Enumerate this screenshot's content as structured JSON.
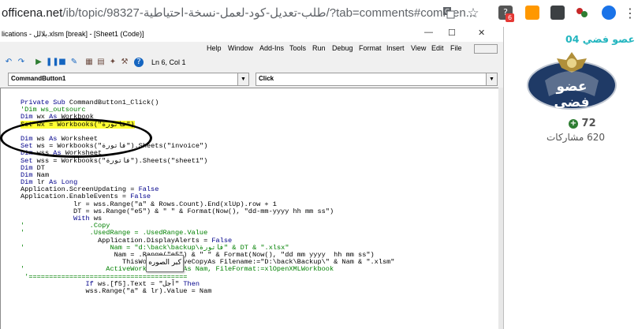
{
  "browser": {
    "url_host": "officena.net",
    "url_path": "/ib/topic/98327-طلب-تعديل-كود-لعمل-نسخة-احتياطية/?tab=comments#commen...",
    "translate_icon": "translate-icon",
    "star_icon": "bookmark-star-icon",
    "extension_badge": "6"
  },
  "vbe": {
    "title": "lications - بلالل.xlsm [break] - [Sheet1 (Code)]",
    "window_controls": {
      "minimize": "—",
      "restore": "☐",
      "close": "✕"
    },
    "menu": [
      "Help",
      "Window",
      "Add-Ins",
      "Tools",
      "Run",
      "Debug",
      "Format",
      "Insert",
      "View",
      "Edit",
      "File"
    ],
    "cursor_position": "Ln 6, Col 1",
    "object_combo": "CommandButton1",
    "procedure_combo": "Click",
    "code_lines": [
      {
        "parts": [
          {
            "t": "Private Sub ",
            "c": "kw"
          },
          {
            "t": "CommandButton1_Click()",
            "c": ""
          }
        ]
      },
      {
        "parts": [
          {
            "t": "'Dim ws_outsourc",
            "c": "cm"
          }
        ]
      },
      {
        "parts": [
          {
            "t": "Dim ",
            "c": "kw"
          },
          {
            "t": "wx ",
            "c": ""
          },
          {
            "t": "As ",
            "c": "kw"
          },
          {
            "t": "Workbook",
            "c": ""
          }
        ]
      },
      {
        "parts": [
          {
            "t": "Set wx = Workbooks(\"فاتورة\")",
            "c": "hl"
          }
        ]
      },
      {
        "parts": []
      },
      {
        "parts": [
          {
            "t": "Dim ",
            "c": "kw"
          },
          {
            "t": "ws ",
            "c": ""
          },
          {
            "t": "As ",
            "c": "kw"
          },
          {
            "t": "Worksheet",
            "c": ""
          }
        ]
      },
      {
        "parts": [
          {
            "t": "Set ",
            "c": "kw"
          },
          {
            "t": "ws = Workbooks(\"فاتورة\").Sheets(\"invoice\")",
            "c": ""
          }
        ]
      },
      {
        "parts": [
          {
            "t": "Dim ",
            "c": "kw"
          },
          {
            "t": "wss ",
            "c": ""
          },
          {
            "t": "As ",
            "c": "kw"
          },
          {
            "t": "Worksheet",
            "c": ""
          }
        ]
      },
      {
        "parts": [
          {
            "t": "Set ",
            "c": "kw"
          },
          {
            "t": "wss = Workbooks(\"فاتورة\").Sheets(\"sheet1\")",
            "c": ""
          }
        ]
      },
      {
        "parts": [
          {
            "t": "Dim ",
            "c": "kw"
          },
          {
            "t": "DT",
            "c": ""
          }
        ]
      },
      {
        "parts": [
          {
            "t": "Dim ",
            "c": "kw"
          },
          {
            "t": "Nam",
            "c": ""
          }
        ]
      },
      {
        "parts": [
          {
            "t": "Dim ",
            "c": "kw"
          },
          {
            "t": "lr ",
            "c": ""
          },
          {
            "t": "As Long",
            "c": "kw"
          }
        ]
      },
      {
        "parts": [
          {
            "t": "Application.ScreenUpdating = ",
            "c": ""
          },
          {
            "t": "False",
            "c": "kw"
          }
        ]
      },
      {
        "parts": [
          {
            "t": "Application.EnableEvents = ",
            "c": ""
          },
          {
            "t": "False",
            "c": "kw"
          }
        ]
      },
      {
        "parts": [
          {
            "t": "             lr = wss.Range(\"a\" & Rows.Count).End(xlUp).row + 1",
            "c": ""
          }
        ]
      },
      {
        "parts": [
          {
            "t": "             DT = ws.Range(\"e5\") & \" \" & Format(Now(), \"dd-mm-yyyy hh mm ss\")",
            "c": ""
          }
        ]
      },
      {
        "parts": [
          {
            "t": "             ",
            "c": ""
          },
          {
            "t": "With ",
            "c": "kw"
          },
          {
            "t": "ws",
            "c": ""
          }
        ]
      },
      {
        "parts": [
          {
            "t": "'                .Copy",
            "c": "cm"
          }
        ]
      },
      {
        "parts": [
          {
            "t": "'                .UsedRange = .UsedRange.Value",
            "c": "cm"
          }
        ]
      },
      {
        "parts": [
          {
            "t": "                   Application.DisplayAlerts = ",
            "c": ""
          },
          {
            "t": "False",
            "c": "kw"
          }
        ]
      },
      {
        "parts": [
          {
            "t": "'                     Nam = \"d:\\back\\backup\\فاتورة\" & DT & \".xlsx\"",
            "c": "cm"
          }
        ]
      },
      {
        "parts": [
          {
            "t": "                       Nam = .Range(\"e5\") & \" \" & Format(Now(), \"dd mm yyyy  hh mm ss\")",
            "c": ""
          }
        ]
      },
      {
        "parts": [
          {
            "t": "                         ThisWorkbook.SaveCopyAs Filename:=\"D:\\back\\Backup\\\" & Nam & \".xlsm\"",
            "c": ""
          }
        ]
      },
      {
        "parts": [
          {
            "t": "'                    ActiveWorkbook.SaveAs Nam, FileFormat:=xlOpenXMLWorkbook",
            "c": "cm"
          }
        ]
      },
      {
        "parts": [
          {
            "t": " '=======================================",
            "c": "cm"
          }
        ]
      },
      {
        "parts": [
          {
            "t": "                ",
            "c": ""
          },
          {
            "t": "If ",
            "c": "kw"
          },
          {
            "t": "ws.[f5].Text = \"آجل\" ",
            "c": ""
          },
          {
            "t": "Then",
            "c": "kw"
          }
        ]
      },
      {
        "parts": [
          {
            "t": "                wss.Range(\"a\" & lr).Value = Nam",
            "c": ""
          }
        ]
      }
    ],
    "tooltip": "كبر الصوره"
  },
  "profile": {
    "username": "عصو فضي 04",
    "badge_text": "عضو فضي",
    "reputation": "72",
    "posts": "620 مشاركات"
  }
}
